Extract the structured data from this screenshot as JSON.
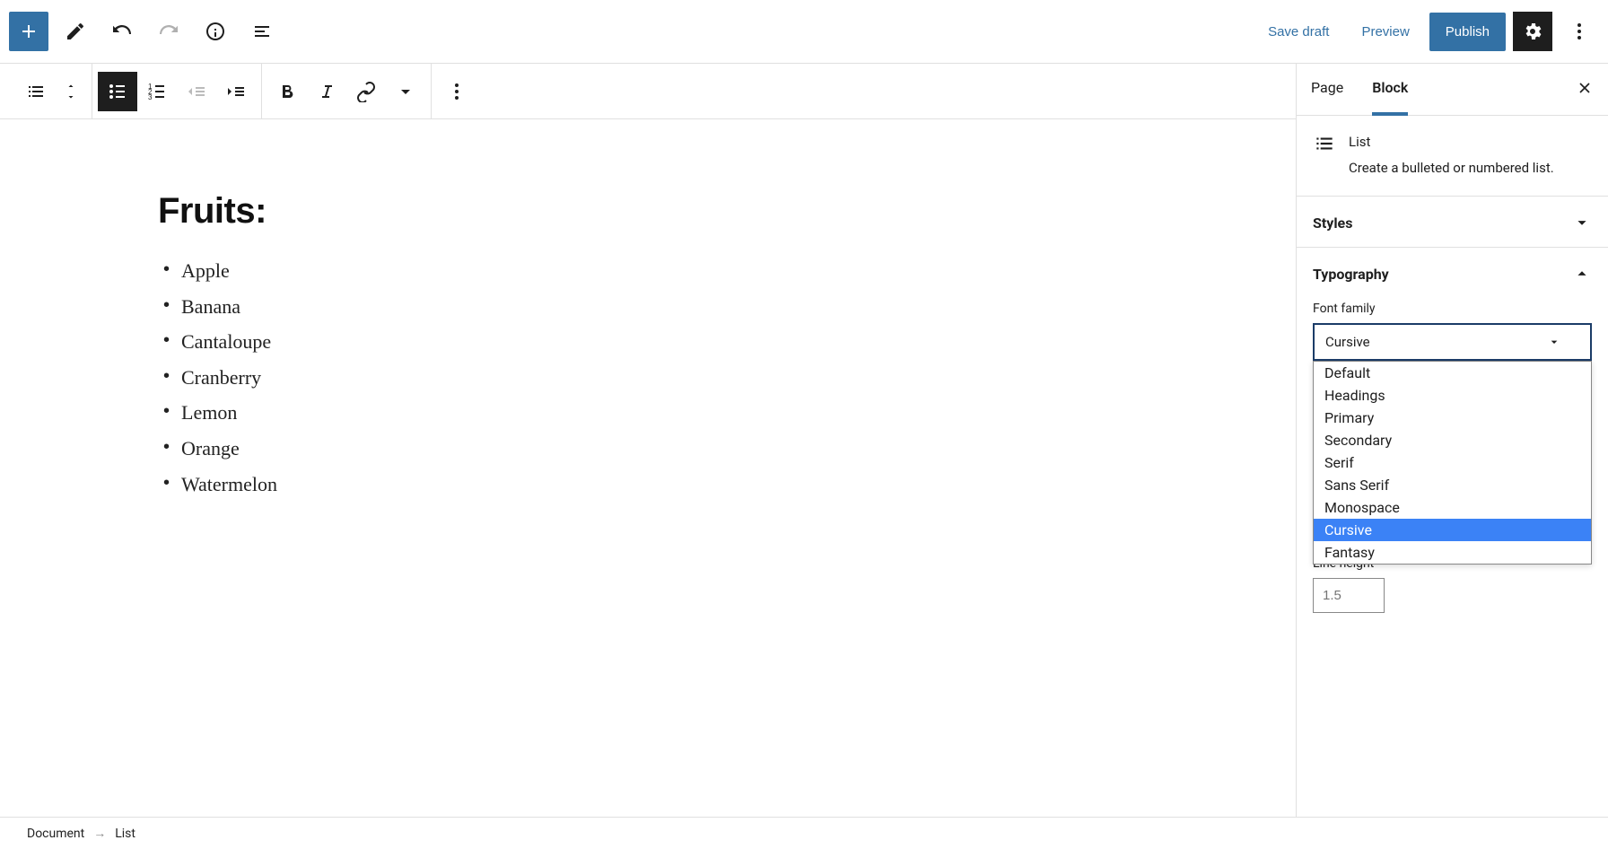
{
  "header": {
    "save_draft": "Save draft",
    "preview": "Preview",
    "publish": "Publish"
  },
  "tabs": {
    "page": "Page",
    "block": "Block"
  },
  "block_panel": {
    "title": "List",
    "description": "Create a bulleted or numbered list."
  },
  "styles_panel": {
    "title": "Styles"
  },
  "typography_panel": {
    "title": "Typography",
    "font_family_label": "Font family",
    "font_family_value": "Cursive",
    "options": [
      "Default",
      "Headings",
      "Primary",
      "Secondary",
      "Serif",
      "Sans Serif",
      "Monospace",
      "Cursive",
      "Fantasy"
    ],
    "selected_index": 7,
    "line_height_label": "Line height",
    "line_height_placeholder": "1.5"
  },
  "content": {
    "heading": "Fruits:",
    "items": [
      "Apple",
      "Banana",
      "Cantaloupe",
      "Cranberry",
      "Lemon",
      "Orange",
      "Watermelon"
    ]
  },
  "breadcrumb": {
    "document": "Document",
    "arrow": "→",
    "list": "List"
  }
}
